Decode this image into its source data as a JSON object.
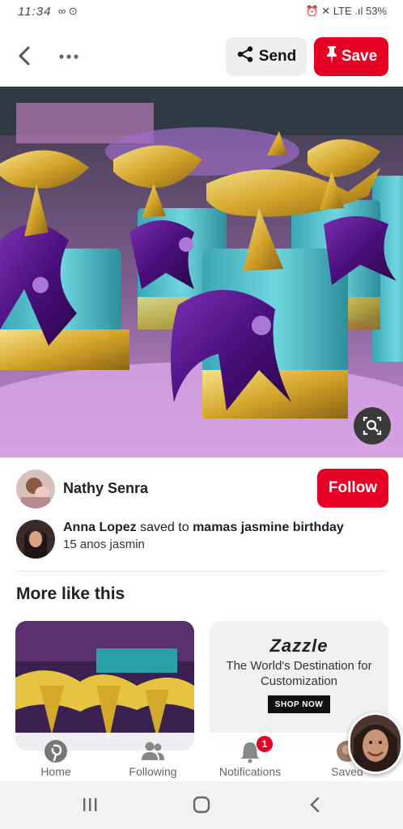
{
  "status_bar": {
    "time": "11:34",
    "extra": "∞ ⊙",
    "right": "⏰ ✕ LTE .ıl 53%"
  },
  "header": {
    "send_label": "Send",
    "save_label": "Save"
  },
  "pin": {
    "creator_name": "Nathy Senra",
    "follow_label": "Follow",
    "saver_name": "Anna Lopez",
    "saved_to_text": "saved to",
    "board_name": "mamas jasmine birthday",
    "note": "15 anos jasmin"
  },
  "more_like_this": {
    "title": "More like this",
    "ad": {
      "brand": "Zazzle",
      "tagline": "The World's Destination for Customization",
      "cta": "SHOP NOW"
    }
  },
  "bottom_nav": {
    "items": [
      {
        "label": "Home",
        "icon": "pinterest-logo-icon"
      },
      {
        "label": "Following",
        "icon": "people-icon"
      },
      {
        "label": "Notifications",
        "icon": "bell-icon",
        "badge": "1"
      },
      {
        "label": "Saved",
        "icon": "profile-avatar"
      }
    ]
  },
  "colors": {
    "brand_red": "#e60023",
    "send_bg": "#efefef"
  }
}
